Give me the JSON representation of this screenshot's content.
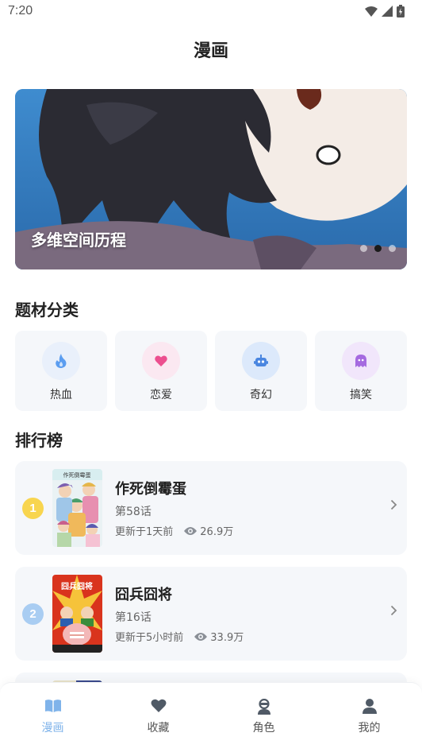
{
  "status": {
    "time": "7:20"
  },
  "header": {
    "title": "漫画"
  },
  "banner": {
    "title": "多维空间历程",
    "dot_count": 3,
    "active_dot": 1
  },
  "genres_section": {
    "title": "题材分类",
    "items": [
      {
        "label": "热血",
        "icon": "flame-icon",
        "color": "#5b9df0",
        "bg": "#e9f0fb"
      },
      {
        "label": "恋爱",
        "icon": "heart-icon",
        "color": "#ec4f8f",
        "bg": "#fbe8f1"
      },
      {
        "label": "奇幻",
        "icon": "robot-icon",
        "color": "#4a86e0",
        "bg": "#dce9fb"
      },
      {
        "label": "搞笑",
        "icon": "ghost-icon",
        "color": "#a56ae0",
        "bg": "#f1e6fb"
      }
    ]
  },
  "ranking_section": {
    "title": "排行榜",
    "items": [
      {
        "rank": "1",
        "badge_color": "#f8d54f",
        "name": "作死倒霉蛋",
        "episode": "第58话",
        "updated": "更新于1天前",
        "views": "26.9万"
      },
      {
        "rank": "2",
        "badge_color": "#a9cdf2",
        "name": "囧兵囧将",
        "episode": "第16话",
        "updated": "更新于5小时前",
        "views": "33.9万"
      }
    ]
  },
  "tabbar": {
    "items": [
      {
        "label": "漫画",
        "icon": "book-icon",
        "active": true
      },
      {
        "label": "收藏",
        "icon": "heart-icon",
        "active": false
      },
      {
        "label": "角色",
        "icon": "character-icon",
        "active": false
      },
      {
        "label": "我的",
        "icon": "user-icon",
        "active": false
      }
    ],
    "active_color": "#7fb3ea"
  }
}
